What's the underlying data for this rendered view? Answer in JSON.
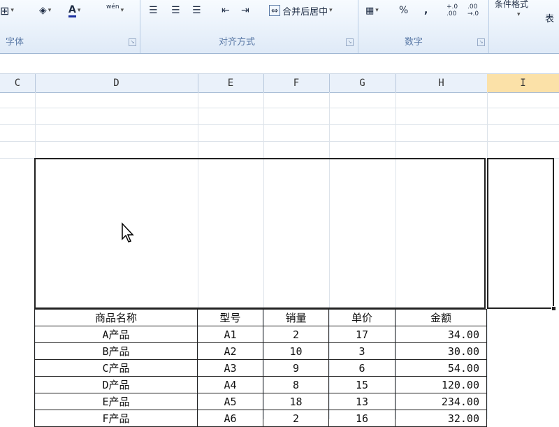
{
  "ribbon": {
    "font_group_label": "字体",
    "align_group_label": "对齐方式",
    "number_group_label": "数字",
    "merge_center_label": "合并后居中",
    "percent_label": "%",
    "comma_label": ",",
    "increase_decimal_label": "+.0 .00",
    "decrease_decimal_label": ".00 →.0",
    "conditional_format_label": "条件格式",
    "table_label": "表",
    "font_color_letter": "A",
    "phonetic_label": "wén"
  },
  "columns": [
    {
      "label": "C"
    },
    {
      "label": "D"
    },
    {
      "label": "E"
    },
    {
      "label": "F"
    },
    {
      "label": "G"
    },
    {
      "label": "H"
    },
    {
      "label": "I",
      "selected": true
    }
  ],
  "table": {
    "headers": [
      "商品名称",
      "型号",
      "销量",
      "单价",
      "金额"
    ],
    "rows": [
      [
        "A产品",
        "A1",
        "2",
        "17",
        "34.00"
      ],
      [
        "B产品",
        "A2",
        "10",
        "3",
        "30.00"
      ],
      [
        "C产品",
        "A3",
        "9",
        "6",
        "54.00"
      ],
      [
        "D产品",
        "A4",
        "8",
        "15",
        "120.00"
      ],
      [
        "E产品",
        "A5",
        "18",
        "13",
        "234.00"
      ],
      [
        "F产品",
        "A6",
        "2",
        "16",
        "32.00"
      ]
    ]
  },
  "colors": {
    "ribbon_bg": "#dfeaf7",
    "header_bg": "#eaf1fa",
    "selected_header_bg": "#fbe1a8",
    "font_color_underline": "#1a2f9e"
  }
}
